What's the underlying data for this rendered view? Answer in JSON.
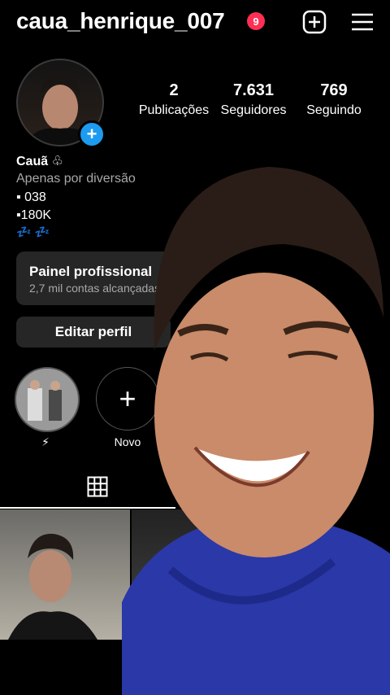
{
  "header": {
    "username": "caua_henrique_007",
    "notification_count": "9"
  },
  "stats": [
    {
      "value": "2",
      "label": "Publicações"
    },
    {
      "value": "7.631",
      "label": "Seguidores"
    },
    {
      "value": "769",
      "label": "Seguindo"
    }
  ],
  "profile": {
    "name": "Cauã ♧",
    "bio_line1": "Apenas por diversão",
    "bio_line2": "▪ 038",
    "bio_line3": "▪180K",
    "bio_line4": "💤 💤"
  },
  "panel": {
    "title": "Painel profissional",
    "subtitle": "2,7 mil contas alcançadas"
  },
  "buttons": {
    "edit_profile": "Editar perfil"
  },
  "highlights": [
    {
      "label": "⚡"
    },
    {
      "label": "Novo"
    }
  ],
  "colors": {
    "background": "#000000",
    "accent": "#1d9bf0",
    "notification": "#ff2f55",
    "button_bg": "#262626"
  }
}
